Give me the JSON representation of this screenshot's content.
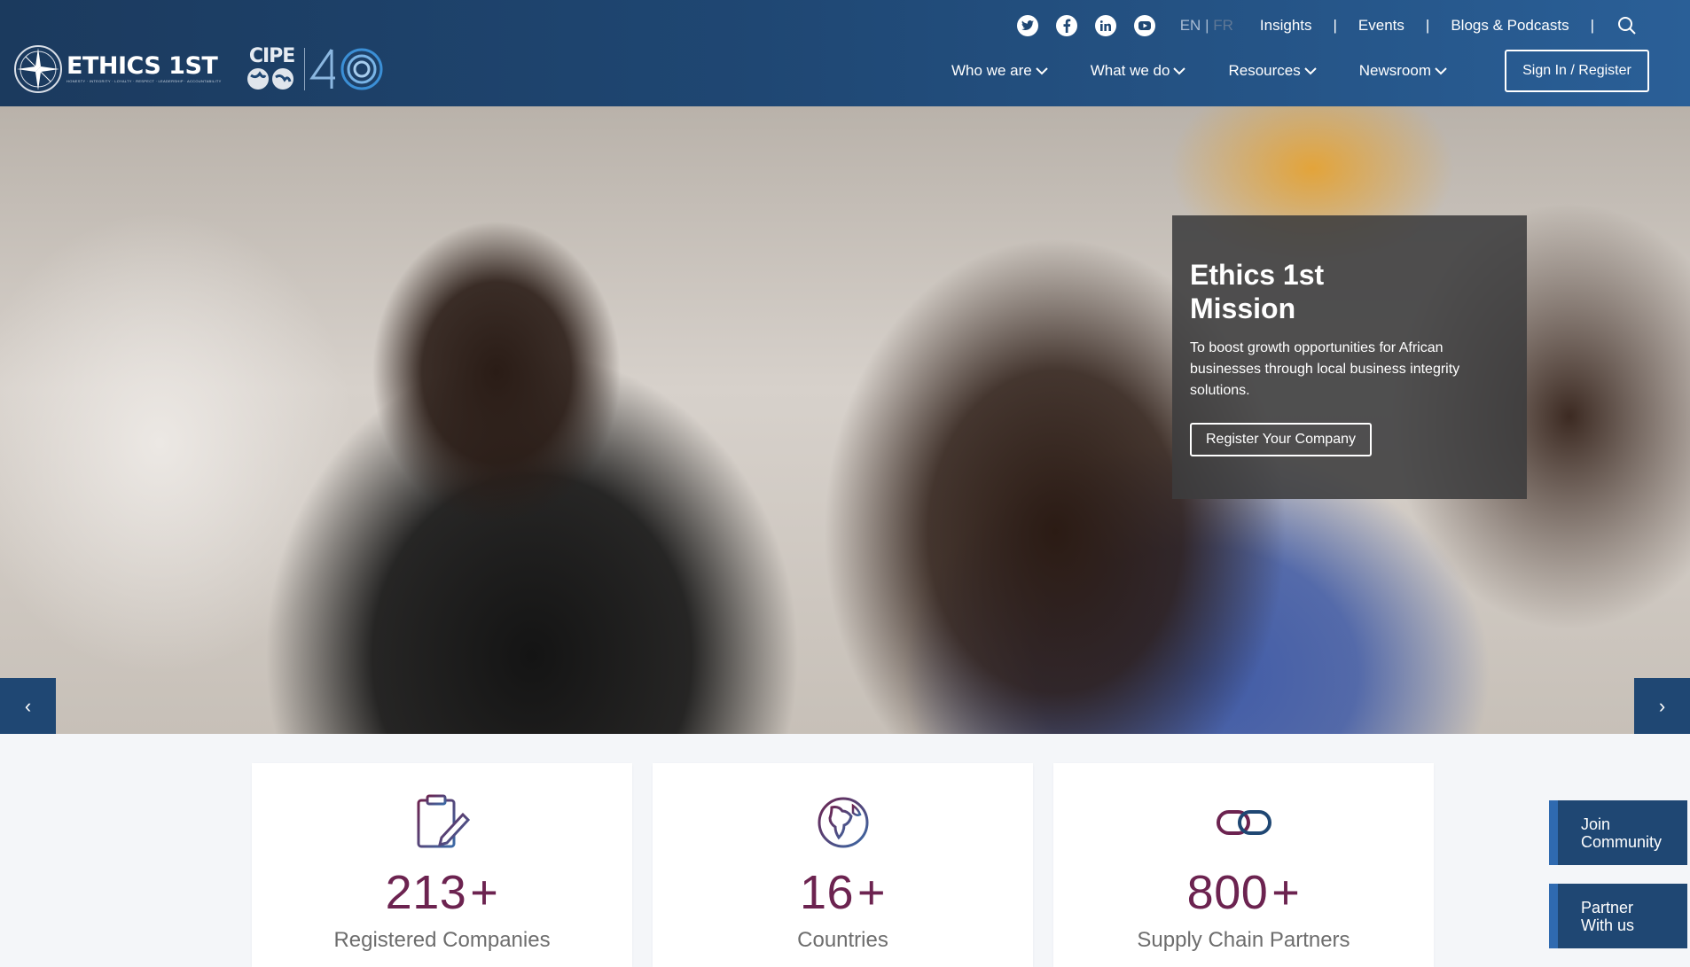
{
  "brand": {
    "ethics_logo_text": "ETHICS 1ST",
    "ethics_tagline": "HONESTY · INTEGRITY · LOYALTY · RESPECT · LEADERSHIP · ACCOUNTABILITY",
    "cipe_logo_text": "CIPE",
    "cipe_anniversary": "40"
  },
  "topbar": {
    "social": [
      {
        "icon": "twitter-icon"
      },
      {
        "icon": "facebook-icon"
      },
      {
        "icon": "linkedin-icon"
      },
      {
        "icon": "youtube-icon"
      }
    ],
    "lang_en": "EN",
    "lang_sep": "|",
    "lang_fr": "FR",
    "links": [
      "Insights",
      "Events",
      "Blogs & Podcasts"
    ],
    "separator": "|"
  },
  "nav": {
    "items": [
      "Who we are",
      "What we do",
      "Resources",
      "Newsroom"
    ],
    "signin_label": "Sign In / Register"
  },
  "hero": {
    "title": "Ethics 1st Mission",
    "title_line1": "Ethics 1st",
    "title_line2": "Mission",
    "text": "To boost growth opportunities for African businesses through local business integrity solutions.",
    "cta": "Register Your Company",
    "prev": "‹",
    "next": "›"
  },
  "stats": [
    {
      "icon": "clipboard-icon",
      "value": "213",
      "suffix": "+",
      "label": "Registered Companies"
    },
    {
      "icon": "globe-icon",
      "value": "16",
      "suffix": "+",
      "label": "Countries"
    },
    {
      "icon": "chain-link-icon",
      "value": "800",
      "suffix": "+",
      "label": "Supply Chain Partners"
    }
  ],
  "side": {
    "join_line1": "Join",
    "join_line2": "Community",
    "partner_line1": "Partner",
    "partner_line2": "With us"
  },
  "colors": {
    "header": "#1f4773",
    "accent_purple": "#6c2350",
    "button_blue": "#1f4773"
  }
}
